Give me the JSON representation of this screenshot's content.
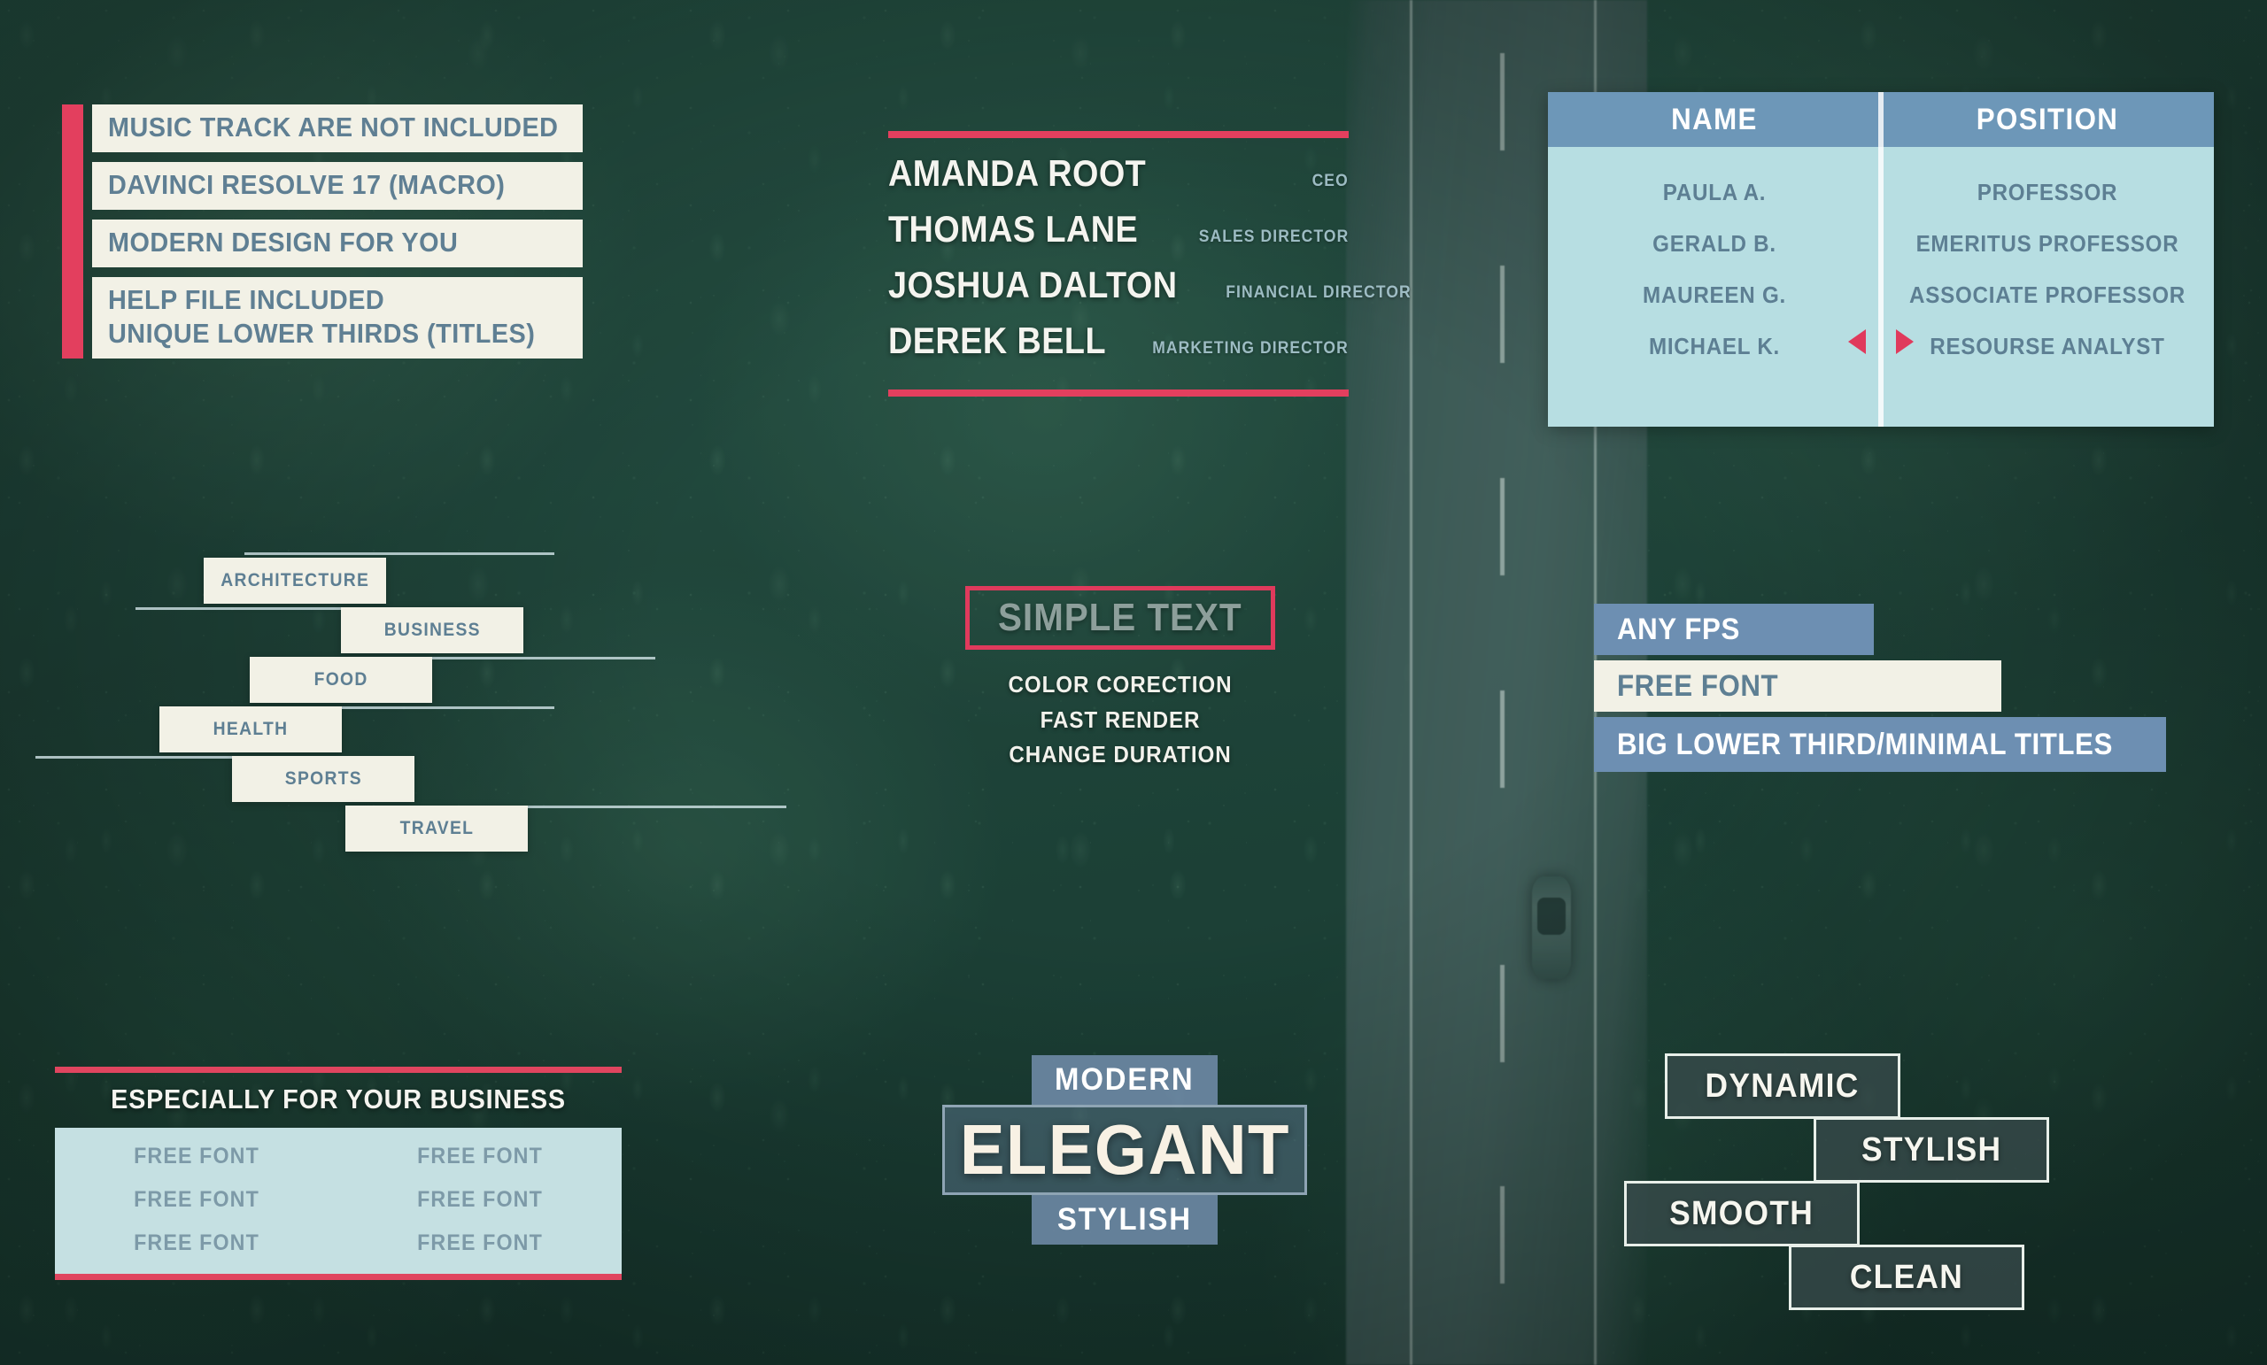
{
  "feature_list": {
    "rows": [
      [
        "MUSIC TRACK ARE NOT INCLUDED"
      ],
      [
        "DAVINCI RESOLVE 17 (MACRO)"
      ],
      [
        "MODERN DESIGN FOR YOU"
      ],
      [
        "HELP FILE INCLUDED",
        "UNIQUE LOWER THIRDS (TITLES)"
      ]
    ]
  },
  "names_panel": {
    "people": [
      {
        "name": "AMANDA ROOT",
        "role": "CEO"
      },
      {
        "name": "THOMAS LANE",
        "role": "SALES DIRECTOR"
      },
      {
        "name": "JOSHUA DALTON",
        "role": "FINANCIAL DIRECTOR"
      },
      {
        "name": "DEREK BELL",
        "role": "MARKETING DIRECTOR"
      }
    ]
  },
  "staff_table": {
    "headers": [
      "NAME",
      "POSITION"
    ],
    "rows": [
      [
        "PAULA A.",
        "PROFESSOR"
      ],
      [
        "GERALD B.",
        "EMERITUS PROFESSOR"
      ],
      [
        "MAUREEN G.",
        "ASSOCIATE PROFESSOR"
      ],
      [
        "MICHAEL K.",
        "RESOURSE ANALYST"
      ]
    ],
    "nav": {
      "prev": "prev-arrow",
      "next": "next-arrow"
    }
  },
  "categories": {
    "items": [
      "ARCHITECTURE",
      "BUSINESS",
      "FOOD",
      "HEALTH",
      "SPORTS",
      "TRAVEL"
    ]
  },
  "simple_text": {
    "headline": "SIMPLE TEXT",
    "bullets": [
      "COLOR CORECTION",
      "FAST RENDER",
      "CHANGE DURATION"
    ]
  },
  "right_bars": {
    "items": [
      "ANY FPS",
      "FREE FONT",
      "BIG LOWER THIRD/MINIMAL TITLES"
    ]
  },
  "business_panel": {
    "title": "ESPECIALLY FOR YOUR BUSINESS",
    "cells": [
      "FREE FONT",
      "FREE FONT",
      "FREE FONT",
      "FREE FONT",
      "FREE FONT",
      "FREE FONT"
    ]
  },
  "elegant_block": {
    "top": "MODERN",
    "middle": "ELEGANT",
    "bottom": "STYLISH"
  },
  "adjectives": {
    "items": [
      "DYNAMIC",
      "STYLISH",
      "SMOOTH",
      "CLEAN"
    ]
  },
  "colors": {
    "accent_red": "#e33f5e",
    "cream": "#f2f1e6",
    "slate_blue_text": "#5e7f93",
    "header_blue": "#6d97b8",
    "table_body": "#b7dee2",
    "bar_blue": "#6d8fb2",
    "forest_green": "#23483d"
  }
}
